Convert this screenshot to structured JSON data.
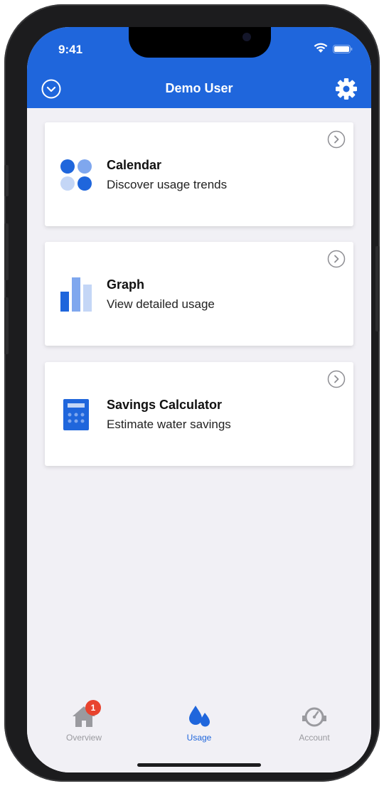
{
  "status_bar": {
    "time": "9:41"
  },
  "nav": {
    "title": "Demo User"
  },
  "cards": [
    {
      "title": "Calendar",
      "subtitle": "Discover usage trends",
      "icon": "calendar-dots-icon"
    },
    {
      "title": "Graph",
      "subtitle": "View detailed usage",
      "icon": "bar-graph-icon"
    },
    {
      "title": "Savings Calculator",
      "subtitle": "Estimate water savings",
      "icon": "calculator-icon"
    }
  ],
  "tabs": [
    {
      "label": "Overview",
      "icon": "house-icon",
      "badge": "1"
    },
    {
      "label": "Usage",
      "icon": "water-drops-icon",
      "selected": true
    },
    {
      "label": "Account",
      "icon": "meter-gauge-icon"
    }
  ],
  "colors": {
    "primary": "#1f66dc",
    "primary_light": "#7fa7ee",
    "primary_pale": "#c4d6f6",
    "background": "#f1f0f5",
    "badge": "#e8432e",
    "inactive": "#9a9a9f"
  }
}
